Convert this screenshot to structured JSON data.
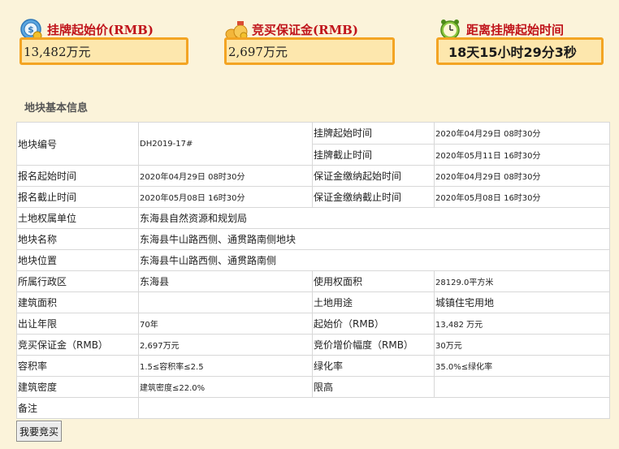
{
  "summary": {
    "start_price_label": "挂牌起始价(RMB)",
    "start_price_value": "13,482万元",
    "deposit_label": "竞买保证金(RMB)",
    "deposit_value": "2,697万元",
    "countdown_label": "距离挂牌起始时间",
    "countdown_value": "18天15小时29分3秒"
  },
  "section_title": "地块基本信息",
  "rows": {
    "r1": {
      "k1": "地块编号",
      "v1": "DH2019-17#",
      "k2": "挂牌起始时间",
      "v2": "2020年04月29日 08时30分"
    },
    "r2": {
      "k2": "挂牌截止时间",
      "v2": "2020年05月11日 16时30分"
    },
    "r3": {
      "k1": "报名起始时间",
      "v1": "2020年04月29日 08时30分",
      "k2": "保证金缴纳起始时间",
      "v2": "2020年04月29日 08时30分"
    },
    "r4": {
      "k1": "报名截止时间",
      "v1": "2020年05月08日 16时30分",
      "k2": "保证金缴纳截止时间",
      "v2": "2020年05月08日 16时30分"
    },
    "r5": {
      "k1": "土地权属单位",
      "v1": "东海县自然资源和规划局"
    },
    "r6": {
      "k1": "地块名称",
      "v1": "东海县牛山路西侧、通贯路南侧地块"
    },
    "r7": {
      "k1": "地块位置",
      "v1": "东海县牛山路西侧、通贯路南侧"
    },
    "r8": {
      "k1": "所属行政区",
      "v1": "东海县",
      "k2": "使用权面积",
      "v2": "28129.0平方米"
    },
    "r9": {
      "k1": "建筑面积",
      "v1": "",
      "k2": "土地用途",
      "v2": "城镇住宅用地"
    },
    "r10": {
      "k1": "出让年限",
      "v1": "70年",
      "k2": "起始价（RMB）",
      "v2": "13,482 万元"
    },
    "r11": {
      "k1": "竞买保证金（RMB）",
      "v1": "2,697万元",
      "k2": "竞价增价幅度（RMB）",
      "v2": "30万元"
    },
    "r12": {
      "k1": "容积率",
      "v1": "1.5≤容积率≤2.5",
      "k2": "绿化率",
      "v2": "35.0%≤绿化率"
    },
    "r13": {
      "k1": "建筑密度",
      "v1": "建筑密度≤22.0%",
      "k2": "限高",
      "v2": ""
    },
    "r14": {
      "k1": "备注",
      "v1": ""
    }
  },
  "bid_button": "我要竞买",
  "colors": {
    "accent": "#c0141b",
    "box_border": "#f3a423",
    "box_fill": "#fde7ad",
    "background": "#fbf3da"
  }
}
